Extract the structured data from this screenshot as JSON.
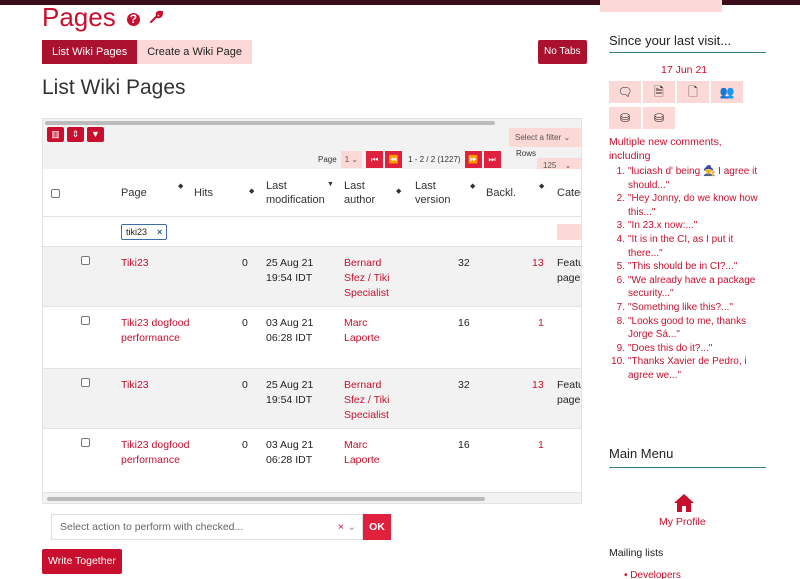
{
  "header": {
    "title": "Pages",
    "help_icon": "question-circle-icon",
    "edit_icon": "wrench-icon"
  },
  "tabs": [
    {
      "label": "List Wiki Pages",
      "active": true
    },
    {
      "label": "Create a Wiki Page",
      "active": false
    }
  ],
  "no_tabs_label": "No Tabs",
  "list_title": "List Wiki Pages",
  "toolbar": {
    "filter_placeholder": "Select a filter",
    "page_label": "Page",
    "page_value": "1",
    "range_text": "1 - 2 / 2 (1227)",
    "rows_label": "Rows",
    "rows_value": "125"
  },
  "columns": [
    "Page",
    "Hits",
    "Last modification",
    "Last author",
    "Last version",
    "Backl.",
    "Categ"
  ],
  "filter_tag": "tiki23",
  "rows": [
    {
      "page": "Tiki23",
      "hits": "0",
      "date": "25 Aug 21",
      "time": "19:54 IDT",
      "author": "Bernard Sfez / Tiki Specialist",
      "version": "32",
      "backlinks": "13",
      "cat": "Featu page"
    },
    {
      "page": "Tiki23 dogfood performance",
      "hits": "0",
      "date": "03 Aug 21",
      "time": "06:28 IDT",
      "author": "Marc Laporte",
      "version": "16",
      "backlinks": "1",
      "cat": ""
    },
    {
      "page": "Tiki23",
      "hits": "0",
      "date": "25 Aug 21",
      "time": "19:54 IDT",
      "author": "Bernard Sfez / Tiki Specialist",
      "version": "32",
      "backlinks": "13",
      "cat": "Featu page"
    },
    {
      "page": "Tiki23 dogfood performance",
      "hits": "0",
      "date": "03 Aug 21",
      "time": "06:28 IDT",
      "author": "Marc Laporte",
      "version": "16",
      "backlinks": "1",
      "cat": ""
    }
  ],
  "actions": {
    "select_placeholder": "Select action to perform with checked...",
    "ok_label": "OK",
    "write_label": "Write Together"
  },
  "sidebar": {
    "since_title": "Since your last visit...",
    "date": "17 Jun 21",
    "intro": "Multiple new comments, including",
    "comments": [
      "\"luciash d' being 🧙 I agree it should...\"",
      "\"Hey Jonny, do we know how this...\"",
      "\"In 23.x now:...\"",
      "\"It is in the CI, as I put it there...\"",
      "\"This should be in CI?...\"",
      "\"We already have a package security...\"",
      "\"Something like this?...\"",
      "\"Looks good to me, thanks Jorge Sá...\"",
      "\"Does this do it?...\"",
      "\"Thanks Xavier de Pedro, i agree we...\""
    ],
    "main_menu_title": "Main Menu",
    "my_profile": "My Profile",
    "mailing_lists": "Mailing lists",
    "mailing_item": "Developers"
  }
}
